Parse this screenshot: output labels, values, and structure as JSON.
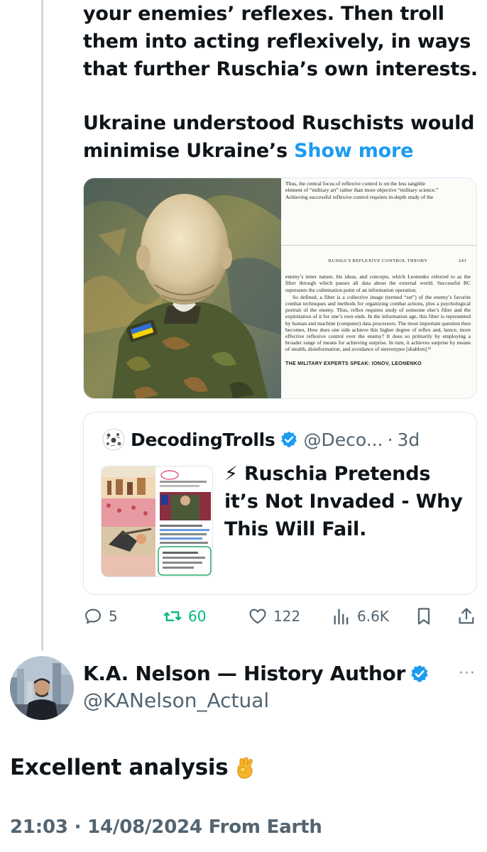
{
  "main_tweet": {
    "text_lines_p1": [
      "your enemies’ reflexes. Then troll",
      "them into acting reflexively, in ways",
      "that further Ruschia’s own interests."
    ],
    "text_lines_p2": [
      "Ukraine understood Ruschists would",
      "minimise Ukraine’s"
    ],
    "show_more_label": "Show more",
    "document_image": {
      "top_lines": [
        "Thus, the central focus of reflexive control is on the less tangible",
        "element of “military art” rather than more objective “military science.”",
        "Achieving successful reflexive control requires in-depth study of the"
      ],
      "running_head": "RUSSIA’S REFLEXIVE CONTROL THEORY",
      "page_number": "243",
      "paragraph_1": "enemy’s inner nature, his ideas, and concepts, which Leonenko referred to as the filter through which passes all data about the external world. Successful RC represents the culmination point of an information operation.",
      "paragraph_2": "So defined, a filter is a collective image (termed “set”) of the enemy’s favorite combat techniques and methods for organizing combat actions, plus a psychological portrait of the enemy. Thus, reflex requires study of someone else’s filter and the exploitation of it for one’s own ends. In the information age, this filter is represented by human and machine (computer) data processors. The most important question then becomes, How does one side achieve this higher degree of reflex and, hence, more effective reflexive control over the enemy? It does so primarily by employing a broader range of means for achieving surprise. In turn, it achieves surprise by means of stealth, disinformation, and avoidance of stereotypes [shablon].¹¹",
      "subheading": "THE MILITARY EXPERTS SPEAK: IONOV, LEONENKO"
    },
    "quoted_tweet": {
      "author_name": "DecodingTrolls",
      "author_handle": "@Deco...",
      "separator": "·",
      "time_ago": "3d",
      "title_lines": [
        "⚡ Ruschia Pretends",
        "it’s Not Invaded - Why",
        "This Will Fail."
      ]
    },
    "actions": {
      "replies": "5",
      "retweets": "60",
      "likes": "122",
      "views": "6.6K"
    }
  },
  "reply": {
    "author_name": "K.A. Nelson — History Author",
    "author_handle": "@KANelson_Actual",
    "more_label": "···",
    "text": "Excellent analysis",
    "timestamp": "21:03 · 14/08/2024 From Earth"
  },
  "colors": {
    "accent": "#1d9bf0",
    "retweet": "#00ba7c",
    "secondary_text": "#536471",
    "border": "#e1e8ed"
  }
}
